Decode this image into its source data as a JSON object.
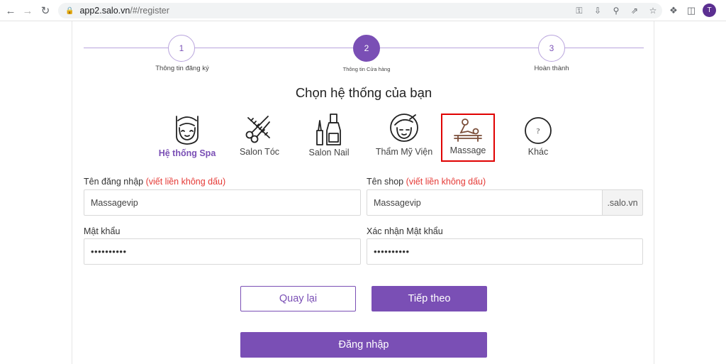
{
  "browser": {
    "url_host": "app2.salo.vn",
    "url_path": "/#/register",
    "avatar_initial": "T"
  },
  "stepper": {
    "steps": [
      {
        "number": "1",
        "label": "Thông tin đăng ký",
        "active": false
      },
      {
        "number": "2",
        "label": "Thông tin Cửa hàng",
        "active": true
      },
      {
        "number": "3",
        "label": "Hoàn thành",
        "active": false
      }
    ]
  },
  "heading": "Chọn hệ thống của bạn",
  "systems": [
    {
      "label": "Hệ thống Spa",
      "icon": "spa-face-icon",
      "selected": true
    },
    {
      "label": "Salon Tóc",
      "icon": "scissors-comb-icon",
      "selected": false
    },
    {
      "label": "Salon Nail",
      "icon": "nail-polish-icon",
      "selected": false
    },
    {
      "label": "Thẩm Mỹ Viện",
      "icon": "beauty-face-icon",
      "selected": false
    },
    {
      "label": "Massage",
      "icon": "massage-icon",
      "selected": false,
      "highlighted": true
    },
    {
      "label": "Khác",
      "icon": "question-icon",
      "selected": false
    }
  ],
  "form": {
    "username_label": "Tên đăng nhập",
    "username_hint": "(viết liền không dấu)",
    "username_value": "Massagevip",
    "shop_label": "Tên shop",
    "shop_hint": "(viết liền không dấu)",
    "shop_value": "Massagevip",
    "shop_suffix": ".salo.vn",
    "password_label": "Mật khẩu",
    "password_value": "••••••••••",
    "confirm_label": "Xác nhận Mật khẩu",
    "confirm_value": "••••••••••"
  },
  "buttons": {
    "back": "Quay lại",
    "next": "Tiếp theo",
    "login": "Đăng nhập"
  },
  "colors": {
    "accent": "#7a4fb5",
    "hint": "#e53935",
    "highlight_box": "#e00000"
  }
}
